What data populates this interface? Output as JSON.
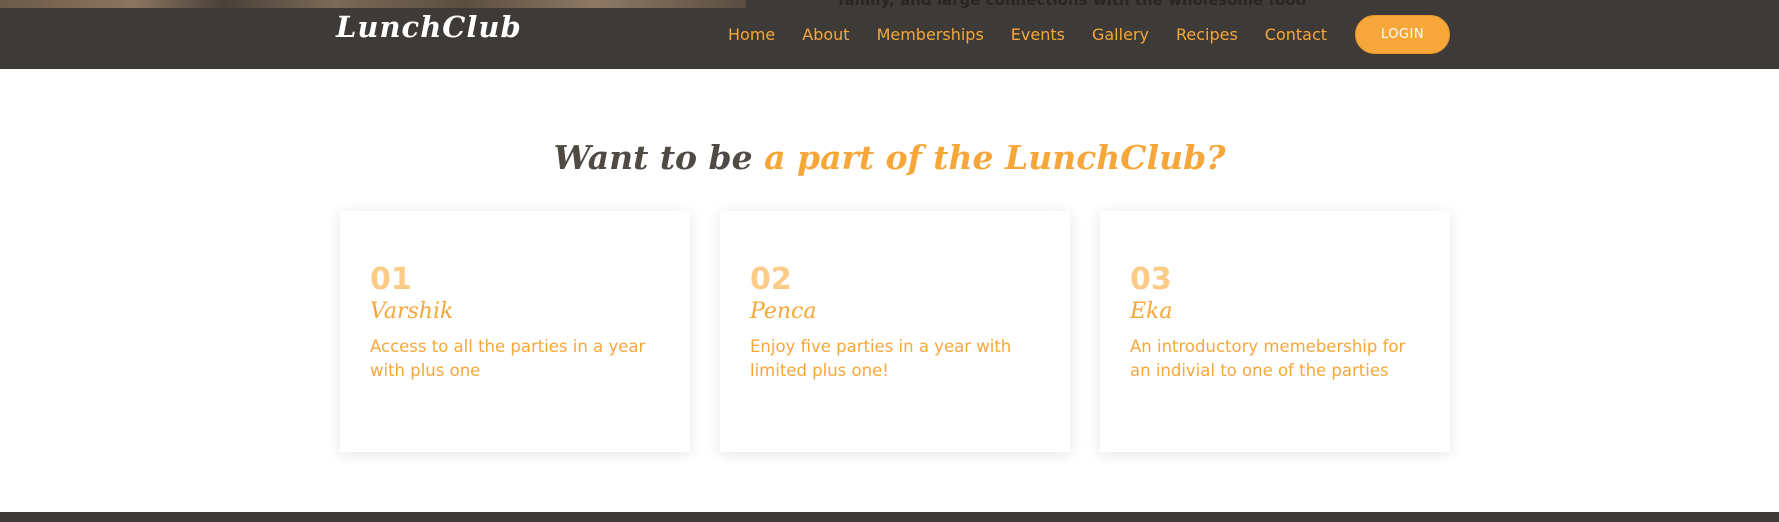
{
  "header": {
    "brand": "LunchClub",
    "hero_peek_text": "family, and large connections with the wholesome food",
    "nav": {
      "home": "Home",
      "about": "About",
      "memberships": "Memberships",
      "events": "Events",
      "gallery": "Gallery",
      "recipes": "Recipes",
      "contact": "Contact"
    },
    "login_label": "LOGIN"
  },
  "section": {
    "title_part1": "Want to be",
    "title_part2": "a part of the LunchClub?"
  },
  "memberships": [
    {
      "number": "01",
      "name": "Varshik",
      "description": "Access to all the parties in a year with plus one"
    },
    {
      "number": "02",
      "name": "Penca",
      "description": "Enjoy five parties in a year with limited plus one!"
    },
    {
      "number": "03",
      "name": "Eka",
      "description": "An introductory memebership for an indivial to one of the parties"
    }
  ],
  "colors": {
    "nav_bg": "#3d3a37",
    "accent": "#f7a739",
    "accent_light": "#fbcb87",
    "heading_dark": "#4f4a44"
  }
}
